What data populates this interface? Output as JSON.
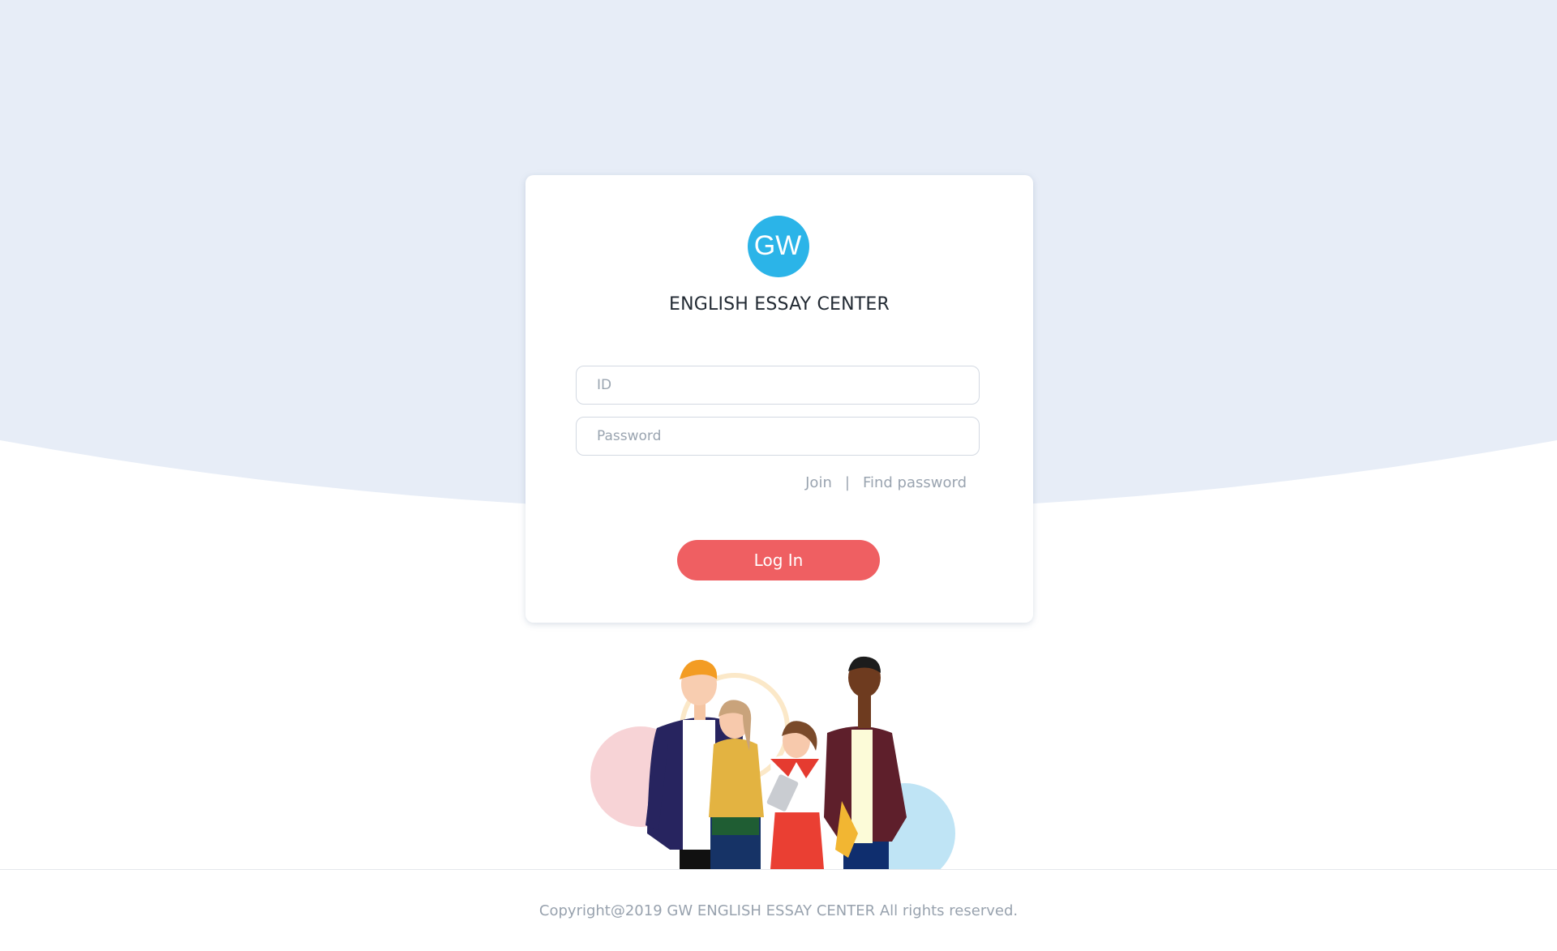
{
  "app": {
    "logo_text": "GW",
    "title": "ENGLISH ESSAY CENTER"
  },
  "form": {
    "id_placeholder": "ID",
    "id_value": "",
    "password_placeholder": "Password",
    "password_value": "",
    "join_label": "Join",
    "separator": "|",
    "find_password_label": "Find password",
    "login_label": "Log In"
  },
  "footer": {
    "copyright": "Copyright@2019 GW ENGLISH ESSAY CENTER All rights reserved."
  },
  "colors": {
    "background_top": "#e7edf7",
    "logo": "#2bb4e8",
    "login_button": "#ef5f62",
    "muted_text": "#9aa4b0"
  },
  "icons": {
    "logo": "gw-logo-icon",
    "illustration": "people-group-illustration"
  }
}
